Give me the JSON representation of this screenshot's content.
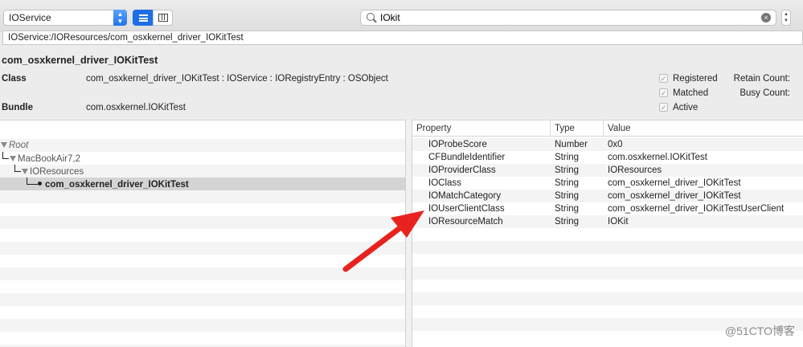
{
  "toolbar": {
    "plane": "IOService",
    "search_value": "IOkit",
    "clear_glyph": "×"
  },
  "path": "IOService:/IOResources/com_osxkernel_driver_IOKitTest",
  "info": {
    "title": "com_osxkernel_driver_IOKitTest",
    "class_label": "Class",
    "class_value": "com_osxkernel_driver_IOKitTest : IOService : IORegistryEntry : OSObject",
    "bundle_label": "Bundle",
    "bundle_value": "com.osxkernel.IOKitTest",
    "checks": {
      "registered": "Registered",
      "matched": "Matched",
      "active": "Active"
    },
    "retain_count_label": "Retain Count:",
    "busy_count_label": "Busy Count:"
  },
  "tree": {
    "root": "Root",
    "machine": "MacBookAir7,2",
    "resources": "IOResources",
    "selected": "com_osxkernel_driver_IOKitTest"
  },
  "properties": {
    "headers": {
      "property": "Property",
      "type": "Type",
      "value": "Value"
    },
    "rows": [
      {
        "property": "IOProbeScore",
        "type": "Number",
        "value": "0x0"
      },
      {
        "property": "CFBundleIdentifier",
        "type": "String",
        "value": "com.osxkernel.IOKitTest"
      },
      {
        "property": "IOProviderClass",
        "type": "String",
        "value": "IOResources"
      },
      {
        "property": "IOClass",
        "type": "String",
        "value": "com_osxkernel_driver_IOKitTest"
      },
      {
        "property": "IOMatchCategory",
        "type": "String",
        "value": "com_osxkernel_driver_IOKitTest"
      },
      {
        "property": "IOUserClientClass",
        "type": "String",
        "value": "com_osxkernel_driver_IOKitTestUserClient"
      },
      {
        "property": "IOResourceMatch",
        "type": "String",
        "value": "IOKit"
      }
    ]
  },
  "watermark": "@51CTO博客",
  "colors": {
    "accent": "#1e6fe6",
    "arrow": "#e8231f"
  }
}
